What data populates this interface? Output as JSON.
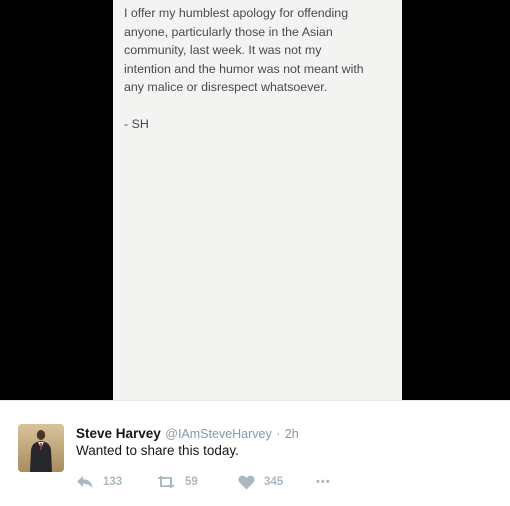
{
  "note": {
    "lines": [
      "I offer my humblest apology for offending",
      "anyone, particularly those in the Asian",
      "community, last week.  It was not my",
      "intention and the humor was not meant with",
      "any malice or disrespect whatsoever."
    ],
    "signature": "- SH"
  },
  "tweet": {
    "name": "Steve Harvey",
    "handle": "@IAmSteveHarvey",
    "separator": "·",
    "time": "2h",
    "text": "Wanted to share this today."
  },
  "actions": {
    "reply_count": "133",
    "retweet_count": "59",
    "like_count": "345",
    "more_label": "•••"
  },
  "icons": {
    "reply": "reply-icon",
    "retweet": "retweet-icon",
    "like": "heart-icon",
    "more": "more-icon"
  },
  "colors": {
    "icon_gray": "#aab8c2",
    "name_text": "#14171a",
    "meta_text": "#8899a6",
    "note_background": "#f3f3f2"
  }
}
